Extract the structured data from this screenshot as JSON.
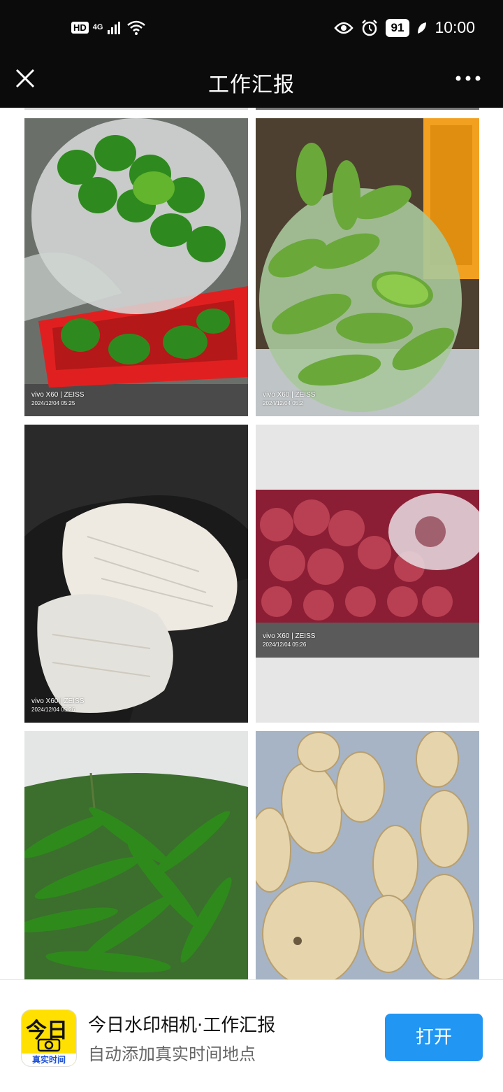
{
  "status_bar": {
    "hd": "HD",
    "network": "4G",
    "battery": "91",
    "time": "10:00"
  },
  "header": {
    "title": "工作汇报"
  },
  "photos": [
    {
      "id": "green-peppers-basket",
      "watermark": "vivo X60 | ZEISS",
      "date": "2024/12/04 05:25"
    },
    {
      "id": "green-chilies-bag",
      "watermark": "vivo X60 | ZEISS",
      "date": "2024/12/04 05:2"
    },
    {
      "id": "enoki-mushrooms",
      "watermark": "vivo X60 | ZEISS",
      "date": "2024/12/04 05:26"
    },
    {
      "id": "red-onions",
      "watermark": "vivo X60 | ZEISS",
      "date": "2024/12/04 05:26"
    },
    {
      "id": "long-green-peppers",
      "watermark": "",
      "date": ""
    },
    {
      "id": "lotus-root",
      "watermark": "",
      "date": ""
    }
  ],
  "banner": {
    "app_icon_big": "今日",
    "app_icon_small": "真实时间",
    "title": "今日水印相机·工作汇报",
    "subtitle": "自动添加真实时间地点",
    "open_label": "打开"
  },
  "colors": {
    "bar_bg": "#0b0b0b",
    "button_blue": "#2196f3",
    "app_icon_yellow": "#ffe000"
  }
}
